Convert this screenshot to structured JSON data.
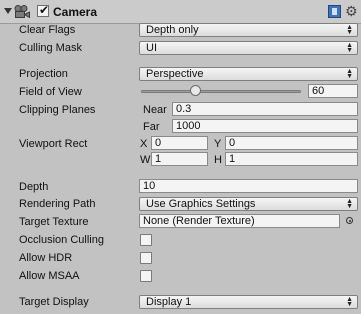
{
  "component": {
    "title": "Camera",
    "enabled": true
  },
  "rows": {
    "clear_flags": {
      "label": "Clear Flags",
      "value": "Depth only"
    },
    "culling_mask": {
      "label": "Culling Mask",
      "value": "UI"
    },
    "projection": {
      "label": "Projection",
      "value": "Perspective"
    },
    "field_of_view": {
      "label": "Field of View",
      "value": "60",
      "slider_fraction": 0.33
    },
    "clipping_planes": {
      "label": "Clipping Planes",
      "near_label": "Near",
      "near_value": "0.3",
      "far_label": "Far",
      "far_value": "1000"
    },
    "viewport_rect": {
      "label": "Viewport Rect",
      "x_label": "X",
      "x_value": "0",
      "y_label": "Y",
      "y_value": "0",
      "w_label": "W",
      "w_value": "1",
      "h_label": "H",
      "h_value": "1"
    },
    "depth": {
      "label": "Depth",
      "value": "10"
    },
    "rendering_path": {
      "label": "Rendering Path",
      "value": "Use Graphics Settings"
    },
    "target_texture": {
      "label": "Target Texture",
      "value": "None (Render Texture)"
    },
    "occlusion_culling": {
      "label": "Occlusion Culling",
      "checked": false
    },
    "allow_hdr": {
      "label": "Allow HDR",
      "checked": false
    },
    "allow_msaa": {
      "label": "Allow MSAA",
      "checked": false
    },
    "target_display": {
      "label": "Target Display",
      "value": "Display 1"
    }
  },
  "icons": {
    "foldout": "foldout-arrow-icon",
    "camera": "camera-icon",
    "help": "book-icon",
    "settings": "gear-icon",
    "object_picker": "target-icon",
    "dropdown": "dropdown-arrows-icon"
  }
}
